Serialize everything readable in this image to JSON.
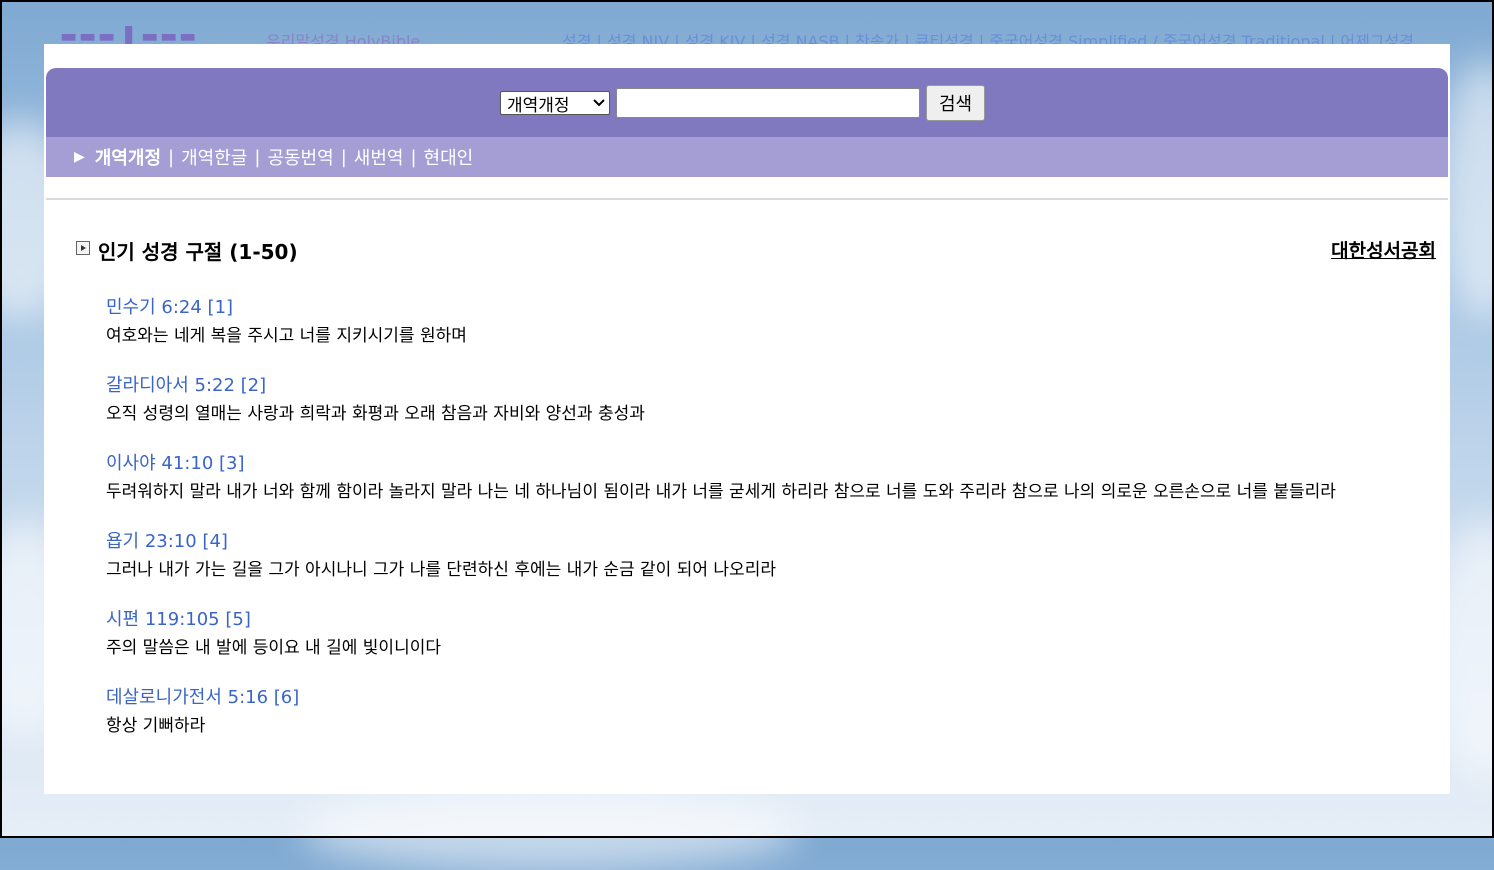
{
  "topbar": {
    "tagline": "우리말성경 HolyBible",
    "links_text": "성경 | 성경 NIV | 성경 KJV | 성경 NASB | 찬송가 | 큐티성경 | 중국어성경 Simplified / 중국어성경 Traditional | 어제그성경"
  },
  "search": {
    "selected_version": "개역개정",
    "input_value": "",
    "button_label": "검색"
  },
  "tabs": [
    {
      "label": "개역개정",
      "active": true
    },
    {
      "label": "개역한글",
      "active": false
    },
    {
      "label": "공동번역",
      "active": false
    },
    {
      "label": "새번역",
      "active": false
    },
    {
      "label": "현대인",
      "active": false
    }
  ],
  "tab_separator": "|",
  "section": {
    "title": "인기 성경 구절 (1-50)",
    "publisher_link": "대한성서공회"
  },
  "verses": [
    {
      "ref": "민수기 6:24 [1]",
      "text": "여호와는 네게 복을 주시고 너를 지키시기를 원하며"
    },
    {
      "ref": "갈라디아서 5:22 [2]",
      "text": "오직 성령의 열매는 사랑과 희락과 화평과 오래 참음과 자비와 양선과 충성과"
    },
    {
      "ref": "이사야 41:10 [3]",
      "text": "두려워하지 말라 내가 너와 함께 함이라 놀라지 말라 나는 네 하나님이 됨이라 내가 너를 굳세게 하리라 참으로 너를 도와 주리라 참으로 나의 의로운 오른손으로 너를 붙들리라"
    },
    {
      "ref": "욥기 23:10 [4]",
      "text": "그러나 내가 가는 길을 그가 아시나니 그가 나를 단련하신 후에는 내가 순금 같이 되어 나오리라"
    },
    {
      "ref": "시편 119:105 [5]",
      "text": "주의 말씀은 내 발에 등이요 내 길에 빛이니이다"
    },
    {
      "ref": "데살로니가전서 5:16 [6]",
      "text": "항상 기뻐하라"
    }
  ],
  "colors": {
    "accent": "#8079bf",
    "tab_bar": "#a49ed5",
    "link": "#3a65c8"
  }
}
